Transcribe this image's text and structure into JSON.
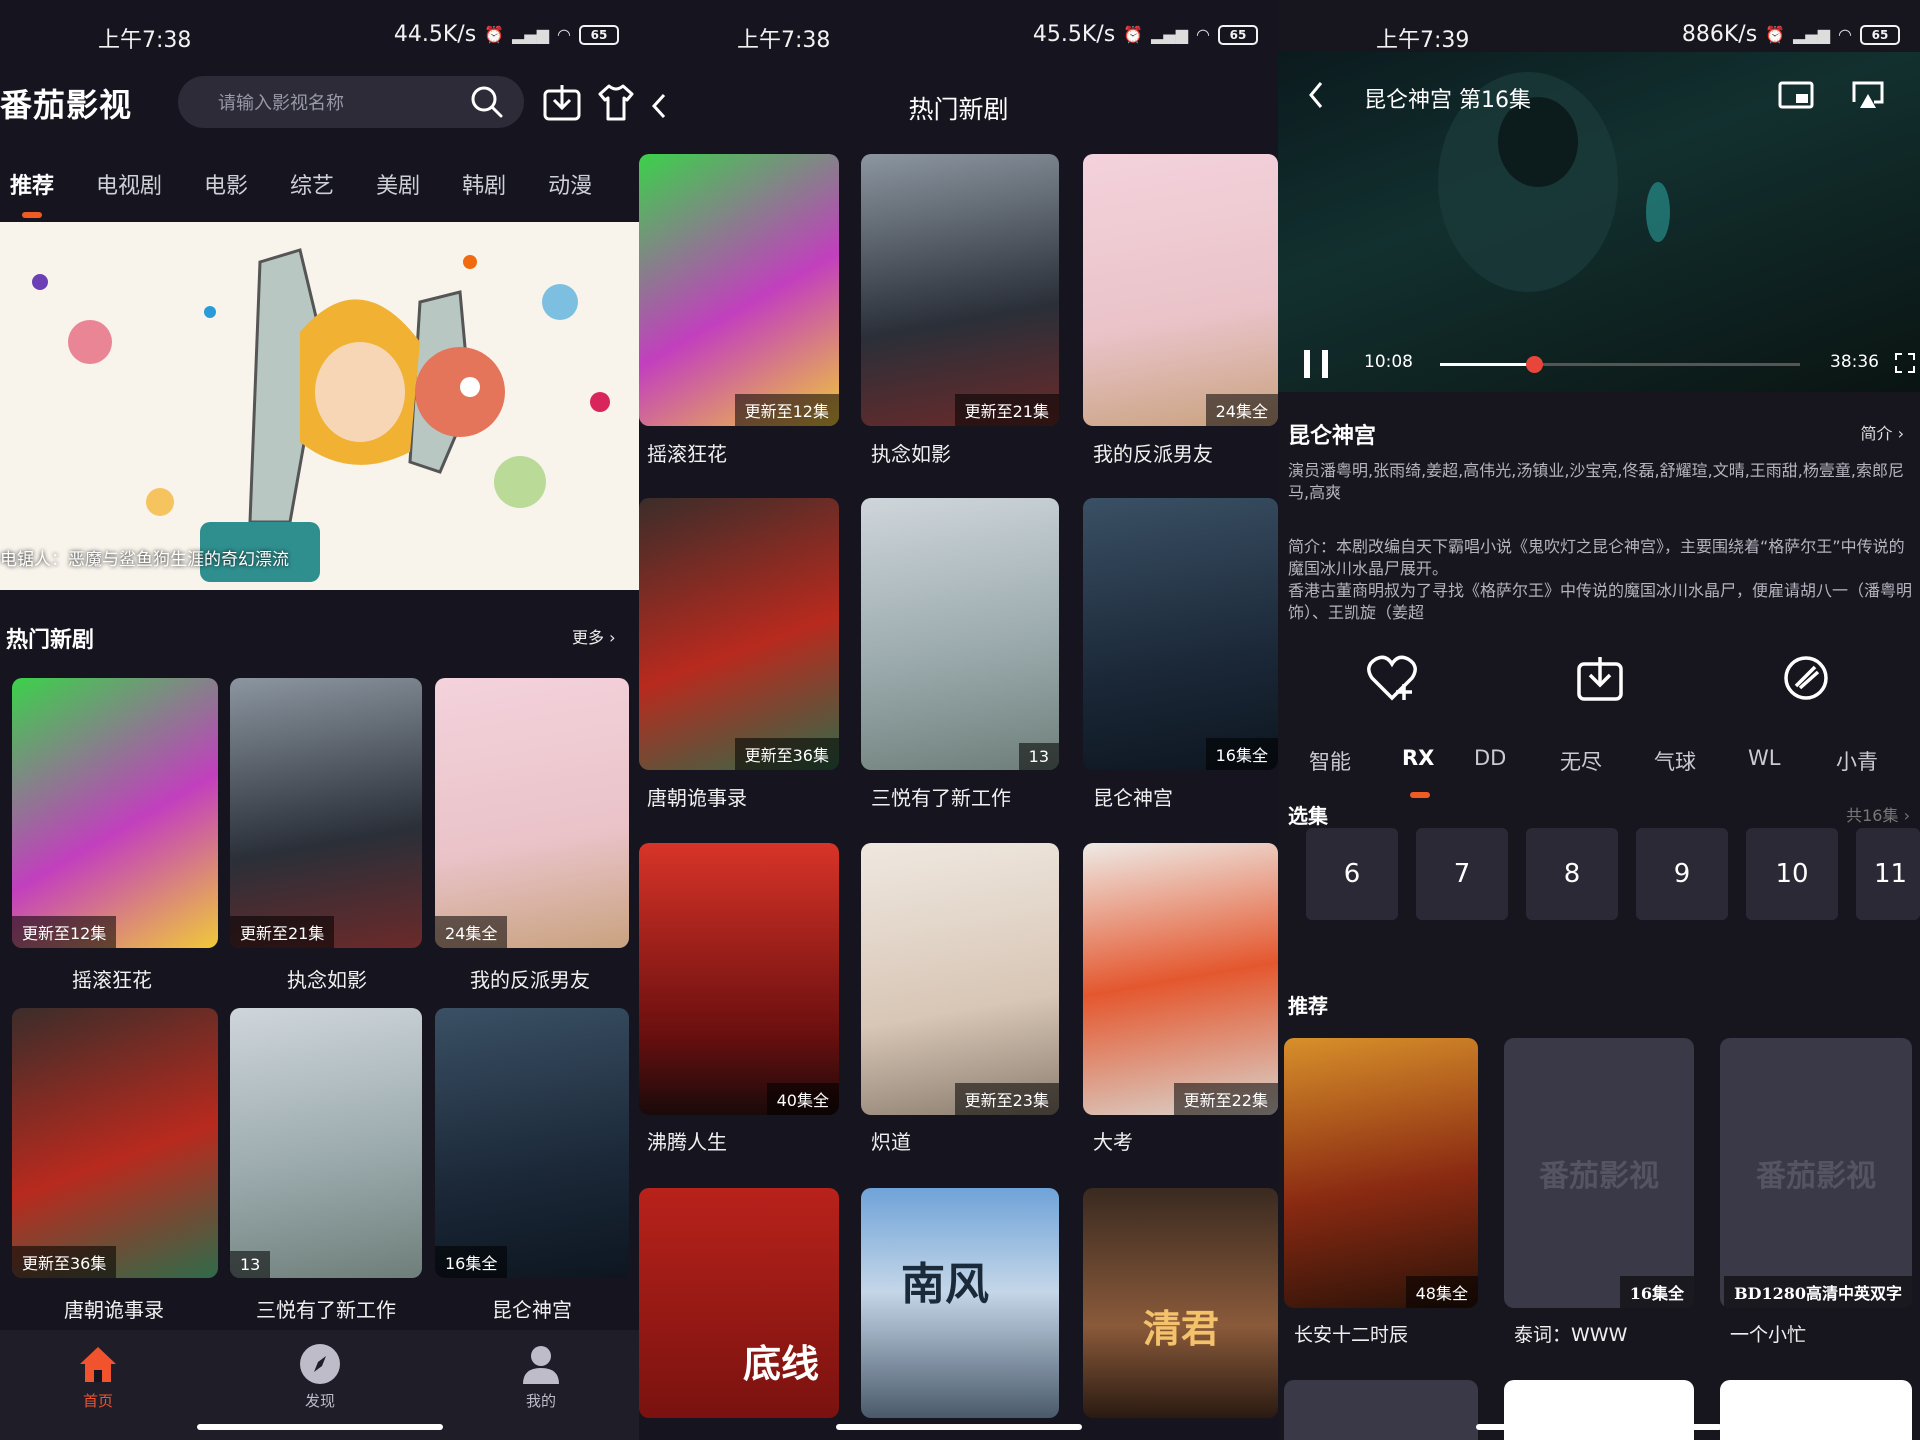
{
  "status_bars": [
    {
      "time": "上午7:38",
      "speed": "44.5K/s",
      "battery": "65"
    },
    {
      "time": "上午7:38",
      "speed": "45.5K/s",
      "battery": "65"
    },
    {
      "time": "上午7:39",
      "speed": "886K/s",
      "battery": "65"
    }
  ],
  "home": {
    "brand": "番茄影视",
    "search_placeholder": "请输入影视名称",
    "tabs": [
      "推荐",
      "电视剧",
      "电影",
      "综艺",
      "美剧",
      "韩剧",
      "动漫"
    ],
    "banner_caption": "电锯人：恶魔与鲨鱼狗生涯的奇幻漂流",
    "section_title": "热门新剧",
    "more_label": "更多",
    "items": [
      {
        "title": "摇滚狂花",
        "badge": "更新至12集"
      },
      {
        "title": "执念如影",
        "badge": "更新至21集"
      },
      {
        "title": "我的反派男友",
        "badge": "24集全"
      },
      {
        "title": "唐朝诡事录",
        "badge": "更新至36集"
      },
      {
        "title": "三悦有了新工作",
        "badge": "13"
      },
      {
        "title": "昆仑神宫",
        "badge": "16集全"
      }
    ],
    "nav": [
      {
        "label": "首页",
        "icon": "home-icon"
      },
      {
        "label": "发现",
        "icon": "compass-icon"
      },
      {
        "label": "我的",
        "icon": "user-icon"
      }
    ]
  },
  "hot": {
    "title": "热门新剧",
    "items": [
      {
        "title": "摇滚狂花",
        "badge": "更新至12集"
      },
      {
        "title": "执念如影",
        "badge": "更新至21集"
      },
      {
        "title": "我的反派男友",
        "badge": "24集全"
      },
      {
        "title": "唐朝诡事录",
        "badge": "更新至36集"
      },
      {
        "title": "三悦有了新工作",
        "badge": "13"
      },
      {
        "title": "昆仑神宫",
        "badge": "16集全"
      },
      {
        "title": "沸腾人生",
        "badge": "40集全"
      },
      {
        "title": "炽道",
        "badge": "更新至23集"
      },
      {
        "title": "大考",
        "badge": "更新至22集"
      },
      {
        "title": "底线",
        "badge": ""
      },
      {
        "title": "南风",
        "badge": ""
      },
      {
        "title": "清君",
        "badge": ""
      }
    ]
  },
  "detail": {
    "player_title": "昆仑神宫 第16集",
    "current_time": "10:08",
    "duration": "38:36",
    "progress": 0.26,
    "show_title": "昆仑神宫",
    "intro_label": "简介",
    "cast": "演员潘粤明,张雨绮,姜超,高伟光,汤镇业,沙宝亮,佟磊,舒耀瑄,文晴,王雨甜,杨壹童,索郎尼马,高爽",
    "synopsis": "简介：本剧改编自天下霸唱小说《鬼吹灯之昆仑神宫》，主要围绕着“格萨尔王”中传说的魔国冰川水晶尸展开。\n    香港古董商明叔为了寻找《格萨尔王》中传说的魔国冰川水晶尸，便雇请胡八一（潘粤明 饰）、王凯旋（姜超",
    "sources": [
      "智能",
      "RX",
      "DD",
      "无尽",
      "气球",
      "WL",
      "小青"
    ],
    "selected_source": 1,
    "episodes_label": "选集",
    "episodes_total": "共16集",
    "episodes": [
      "6",
      "7",
      "8",
      "9",
      "10",
      "11"
    ],
    "recommend_title": "推荐",
    "recommend": [
      {
        "title": "长安十二时辰",
        "badge": "48集全"
      },
      {
        "title": "泰词：WWW",
        "badge": "16集全",
        "placeholder": "番茄影视"
      },
      {
        "title": "一个小忙",
        "badge": "BD1280高清中英双字",
        "placeholder": "番茄影视"
      }
    ]
  }
}
